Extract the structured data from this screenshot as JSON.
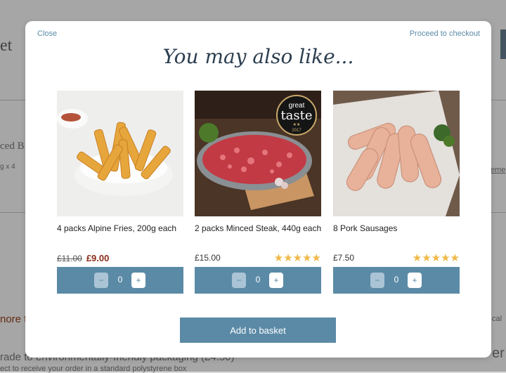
{
  "background": {
    "heading_fragment": "et",
    "product_fragment": "ced B",
    "qty_fragment": "g x 4",
    "link_fragment": "eme",
    "more_fragment": "nore t",
    "right_fragment": "cal",
    "packaging_fragment": "rade to environmentally-friendly packaging (£4.50)",
    "packaging_sub": "ect to receive your order in a standard polystyrene box",
    "right_big_fragment": "er T"
  },
  "modal": {
    "close_label": "Close",
    "checkout_label": "Proceed to checkout",
    "title": "You may also like...",
    "add_button_label": "Add to basket",
    "products": [
      {
        "name": "4 packs Alpine Fries, 200g each",
        "was_price": "£11.00",
        "price": "£9.00",
        "rating": 0,
        "quantity": "0"
      },
      {
        "name": "2 packs Minced Steak, 440g each",
        "price": "£15.00",
        "rating": 5,
        "quantity": "0",
        "badge": {
          "line1": "great",
          "line2": "taste",
          "stars": "★★",
          "year": "2017"
        }
      },
      {
        "name": "8 Pork Sausages",
        "price": "£7.50",
        "rating": 5,
        "quantity": "0"
      }
    ]
  },
  "icons": {
    "minus": "−",
    "plus": "+",
    "star": "★"
  },
  "colors": {
    "accent": "#5b8aa6",
    "sale": "#8b2c1a",
    "star": "#f0b845"
  }
}
